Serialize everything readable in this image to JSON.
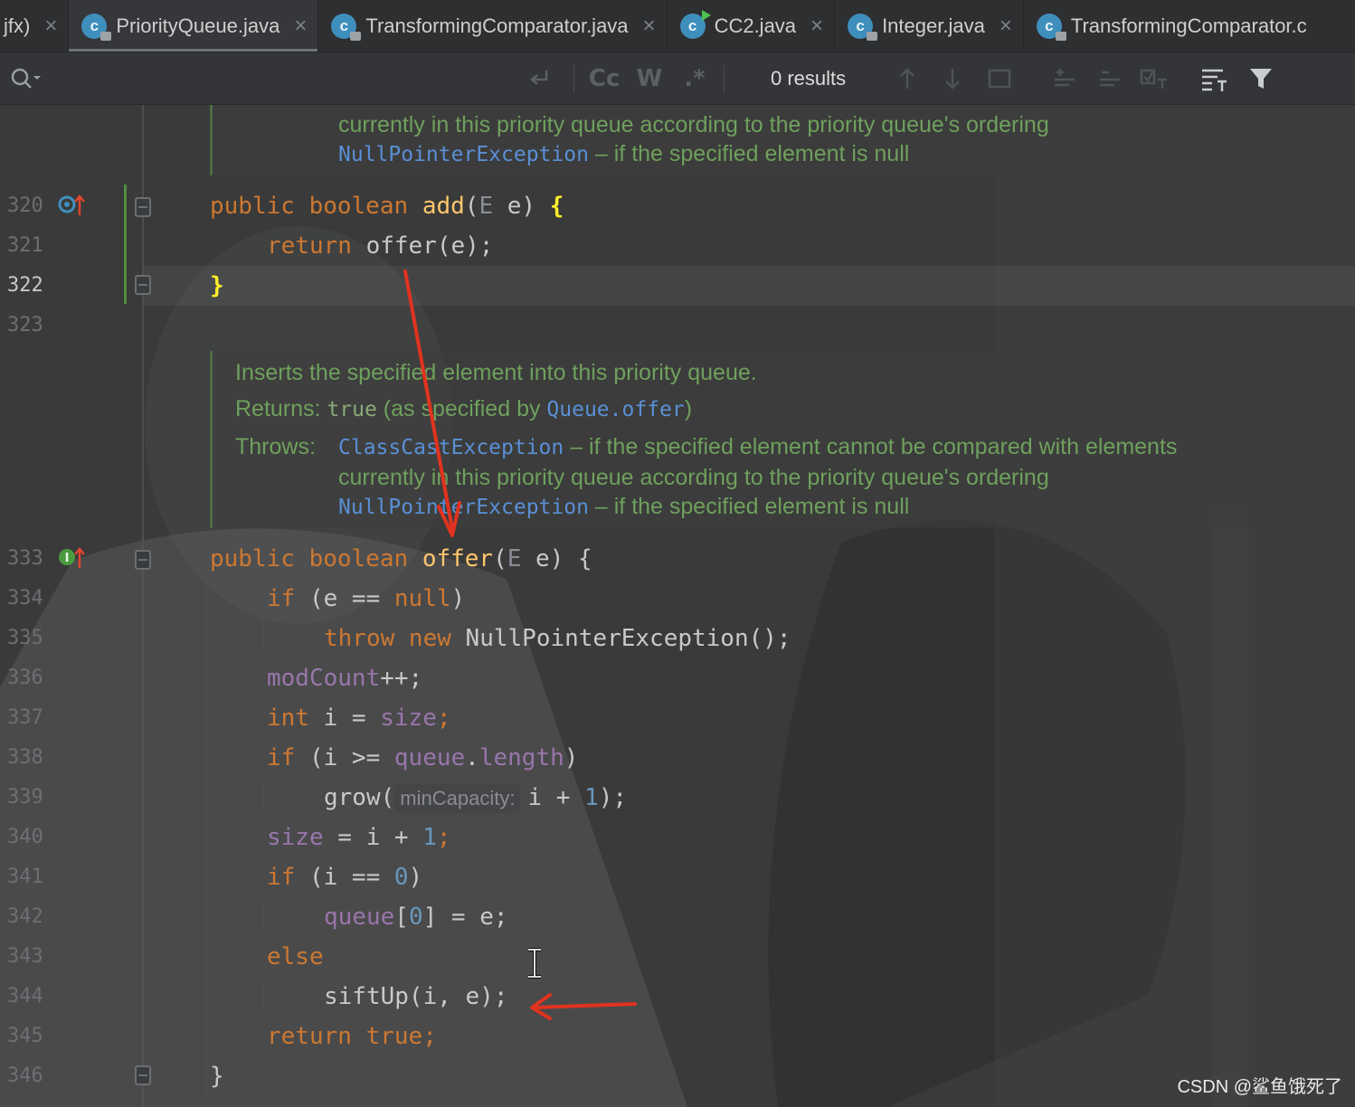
{
  "tabs": [
    {
      "label": "jfx)",
      "active": false,
      "partial": true
    },
    {
      "label": "PriorityQueue.java",
      "active": true
    },
    {
      "label": "TransformingComparator.java",
      "active": false
    },
    {
      "label": "CC2.java",
      "active": false
    },
    {
      "label": "Integer.java",
      "active": false
    },
    {
      "label": "TransformingComparator.c",
      "active": false
    }
  ],
  "find": {
    "results": "0 results",
    "toggles": [
      "Cc",
      "W",
      ".*"
    ]
  },
  "doc_top": {
    "line1": "currently in this priority queue according to the priority queue's ordering",
    "npe": "NullPointerException",
    "npe_rest": " – if the specified element is null"
  },
  "doc_offer": {
    "summary": "Inserts the specified element into this priority queue.",
    "returns_label": "Returns:",
    "returns_true": "true",
    "returns_mid": " (as specified by ",
    "returns_link": "Queue.offer",
    "returns_end": ")",
    "throws_label": "Throws:",
    "cce": "ClassCastException",
    "cce_rest": " – if the specified element cannot be compared with elements",
    "cce_rest2": "currently in this priority queue according to the priority queue's ordering",
    "npe": "NullPointerException",
    "npe_rest": " – if the specified element is null"
  },
  "line_numbers": [
    "320",
    "321",
    "322",
    "323",
    "333",
    "334",
    "335",
    "336",
    "337",
    "338",
    "339",
    "340",
    "341",
    "342",
    "343",
    "344",
    "345",
    "346"
  ],
  "current_line": "322",
  "code": {
    "l320": {
      "a": "public boolean ",
      "b": "add",
      "c": "(",
      "d": "E",
      "e": " e) ",
      "f": "{"
    },
    "l321": {
      "a": "return ",
      "b": "offer(e);"
    },
    "l322": {
      "a": "}"
    },
    "l333": {
      "a": "public boolean ",
      "b": "offer",
      "c": "(",
      "d": "E",
      "e": " e) {"
    },
    "l334": {
      "a": "if ",
      "b": "(e == ",
      "c": "null",
      "d": ")"
    },
    "l335": {
      "a": "throw new ",
      "b": "NullPointerException();"
    },
    "l336": {
      "a": "modCount",
      "b": "++;"
    },
    "l337": {
      "a": "int ",
      "b": "i = ",
      "c": "size",
      "d": ";"
    },
    "l338": {
      "a": "if ",
      "b": "(i >= ",
      "c": "queue",
      "d": ".",
      "e": "length",
      "f": ")"
    },
    "l339": {
      "a": "grow(",
      "hint": "minCapacity:",
      "b": "i + ",
      "c": "1",
      "d": ");"
    },
    "l340": {
      "a": "size",
      "b": " = i + ",
      "c": "1",
      "d": ";"
    },
    "l341": {
      "a": "if ",
      "b": "(i == ",
      "c": "0",
      "d": ")"
    },
    "l342": {
      "a": "queue",
      "b": "[",
      "c": "0",
      "d": "] = e;"
    },
    "l343": {
      "a": "else"
    },
    "l344": {
      "a": "siftUp(i, e);"
    },
    "l345": {
      "a": "return true",
      "b": ";"
    },
    "l346": {
      "a": "}"
    }
  },
  "watermark": "CSDN @鲨鱼饿死了",
  "colors": {
    "keyword": "#cc7832",
    "method": "#ffc66d",
    "field": "#9876aa",
    "number": "#6897bb",
    "doc": "#6fa05d",
    "arrow": "#e0331f"
  }
}
